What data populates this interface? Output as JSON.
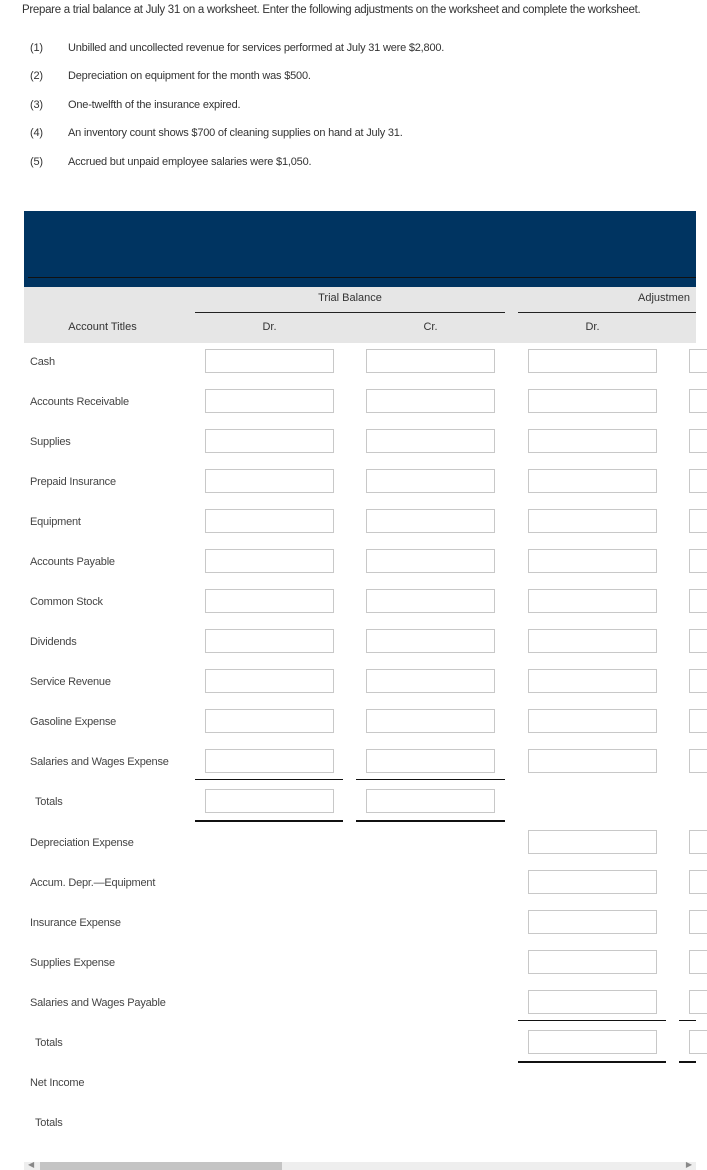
{
  "instructions": "Prepare a trial balance at July 31 on a worksheet. Enter the following adjustments on the worksheet and complete the worksheet.",
  "adjustments": [
    {
      "num": "(1)",
      "text": "Unbilled and uncollected revenue for services performed at July 31 were $2,800."
    },
    {
      "num": "(2)",
      "text": "Depreciation on equipment for the month was $500."
    },
    {
      "num": "(3)",
      "text": "One-twelfth of the insurance expired."
    },
    {
      "num": "(4)",
      "text": "An inventory count shows $700 of cleaning supplies on hand at July 31."
    },
    {
      "num": "(5)",
      "text": "Accrued but unpaid employee salaries were $1,050."
    }
  ],
  "table": {
    "header_color": "#003461",
    "account_titles": "Account Titles",
    "trial_balance": "Trial Balance",
    "adjustments": "Adjustmen",
    "dr": "Dr.",
    "cr": "Cr.",
    "rows": [
      {
        "label": "Cash",
        "fields": [
          "tb_dr",
          "tb_cr",
          "adj_dr",
          "adj_cr"
        ]
      },
      {
        "label": "Accounts Receivable",
        "fields": [
          "tb_dr",
          "tb_cr",
          "adj_dr",
          "adj_cr"
        ]
      },
      {
        "label": "Supplies",
        "fields": [
          "tb_dr",
          "tb_cr",
          "adj_dr",
          "adj_cr"
        ]
      },
      {
        "label": "Prepaid Insurance",
        "fields": [
          "tb_dr",
          "tb_cr",
          "adj_dr",
          "adj_cr"
        ]
      },
      {
        "label": "Equipment",
        "fields": [
          "tb_dr",
          "tb_cr",
          "adj_dr",
          "adj_cr"
        ]
      },
      {
        "label": "Accounts Payable",
        "fields": [
          "tb_dr",
          "tb_cr",
          "adj_dr",
          "adj_cr"
        ]
      },
      {
        "label": "Common Stock",
        "fields": [
          "tb_dr",
          "tb_cr",
          "adj_dr",
          "adj_cr"
        ]
      },
      {
        "label": "Dividends",
        "fields": [
          "tb_dr",
          "tb_cr",
          "adj_dr",
          "adj_cr"
        ]
      },
      {
        "label": "Service Revenue",
        "fields": [
          "tb_dr",
          "tb_cr",
          "adj_dr",
          "adj_cr"
        ]
      },
      {
        "label": "Gasoline Expense",
        "fields": [
          "tb_dr",
          "tb_cr",
          "adj_dr",
          "adj_cr"
        ]
      },
      {
        "label": "Salaries and Wages Expense",
        "fields": [
          "tb_dr",
          "tb_cr",
          "adj_dr",
          "adj_cr"
        ]
      },
      {
        "label": "Totals",
        "indent": true,
        "fields": [
          "tb_dr",
          "tb_cr"
        ]
      },
      {
        "label": "Depreciation Expense",
        "fields": [
          "adj_dr",
          "adj_cr"
        ]
      },
      {
        "label": "Accum. Depr.—Equipment",
        "fields": [
          "adj_dr",
          "adj_cr"
        ]
      },
      {
        "label": "Insurance Expense",
        "fields": [
          "adj_dr",
          "adj_cr"
        ]
      },
      {
        "label": "Supplies Expense",
        "fields": [
          "adj_dr",
          "adj_cr"
        ]
      },
      {
        "label": "Salaries and Wages Payable",
        "fields": [
          "adj_dr",
          "adj_cr"
        ]
      },
      {
        "label": "Totals",
        "indent": true,
        "fields": [
          "adj_dr",
          "adj_cr"
        ]
      },
      {
        "label": "Net Income",
        "fields": []
      },
      {
        "label": "Totals",
        "indent": true,
        "fields": []
      }
    ]
  }
}
